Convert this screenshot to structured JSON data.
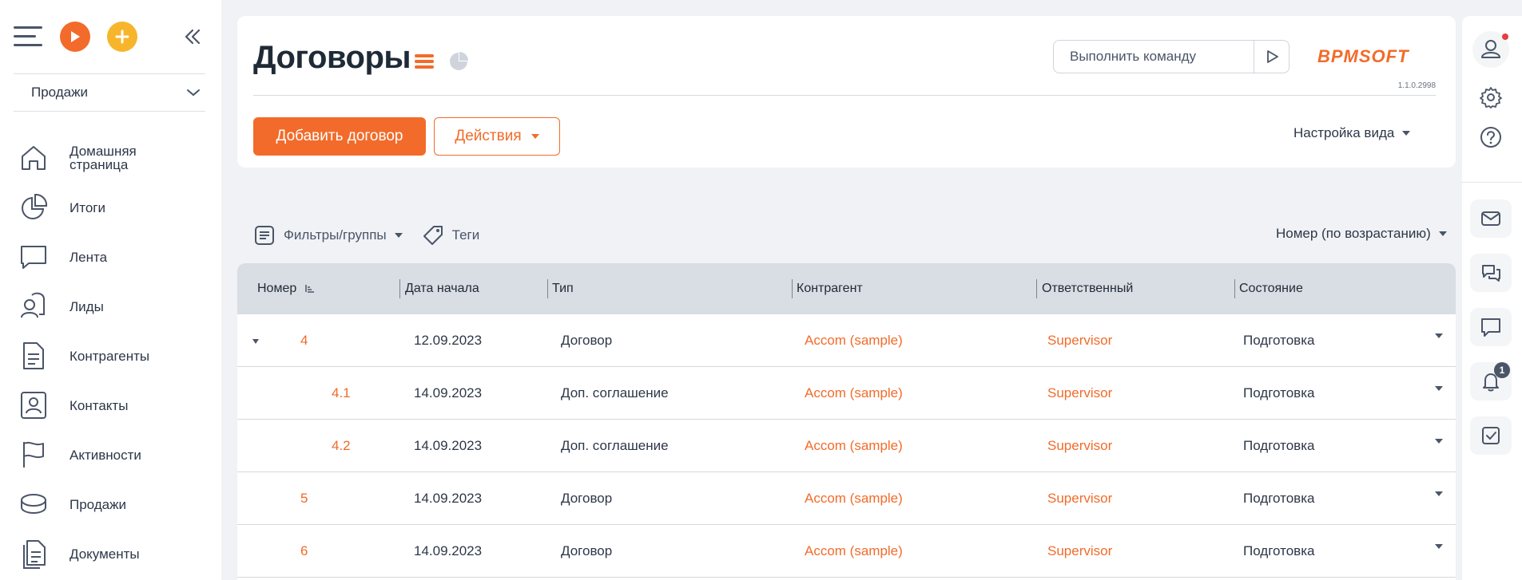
{
  "sidebar": {
    "workspace": "Продажи",
    "items": [
      {
        "label": "Домашняя страница"
      },
      {
        "label": "Итоги"
      },
      {
        "label": "Лента"
      },
      {
        "label": "Лиды"
      },
      {
        "label": "Контрагенты"
      },
      {
        "label": "Контакты"
      },
      {
        "label": "Активности"
      },
      {
        "label": "Продажи"
      },
      {
        "label": "Документы"
      }
    ]
  },
  "header": {
    "title": "Договоры",
    "command_placeholder": "Выполнить команду",
    "brand": "BPMSOFT",
    "version": "1.1.0.2998",
    "add_button": "Добавить договор",
    "actions_button": "Действия",
    "view_settings": "Настройка вида"
  },
  "filters": {
    "filters_label": "Фильтры/группы",
    "tags_label": "Теги",
    "sort_label": "Номер (по возрастанию)"
  },
  "grid": {
    "columns": [
      "Номер",
      "Дата начала",
      "Тип",
      "Контрагент",
      "Ответственный",
      "Состояние"
    ],
    "rows": [
      {
        "number": "4",
        "date": "12.09.2023",
        "type": "Договор",
        "account": "Accom (sample)",
        "owner": "Supervisor",
        "state": "Подготовка"
      },
      {
        "number": "4.1",
        "date": "14.09.2023",
        "type": "Доп. соглашение",
        "account": "Accom (sample)",
        "owner": "Supervisor",
        "state": "Подготовка"
      },
      {
        "number": "4.2",
        "date": "14.09.2023",
        "type": "Доп. соглашение",
        "account": "Accom (sample)",
        "owner": "Supervisor",
        "state": "Подготовка"
      },
      {
        "number": "5",
        "date": "14.09.2023",
        "type": "Договор",
        "account": "Accom (sample)",
        "owner": "Supervisor",
        "state": "Подготовка"
      },
      {
        "number": "6",
        "date": "14.09.2023",
        "type": "Договор",
        "account": "Accom (sample)",
        "owner": "Supervisor",
        "state": "Подготовка"
      }
    ]
  },
  "rail": {
    "notifications_count": "1"
  },
  "colors": {
    "accent": "#f26b2a",
    "play": "#f26b2a",
    "plus": "#f7b52c",
    "header_bg": "#d9dde4"
  },
  "icons": {
    "menu": "hamburger-icon",
    "play": "play-icon",
    "plus": "plus-icon",
    "collapse": "double-chevron-left-icon",
    "list_view": "list-view-icon",
    "chart_view": "pie-chart-icon",
    "run": "play-outline-icon",
    "filters": "filter-list-icon",
    "tags": "tag-icon",
    "profile": "user-icon",
    "settings": "gear-icon",
    "help": "question-icon",
    "email": "mail-icon",
    "chat": "chat-icon",
    "feed": "comment-icon",
    "notifications": "bell-icon",
    "tasks": "checkbox-icon"
  }
}
